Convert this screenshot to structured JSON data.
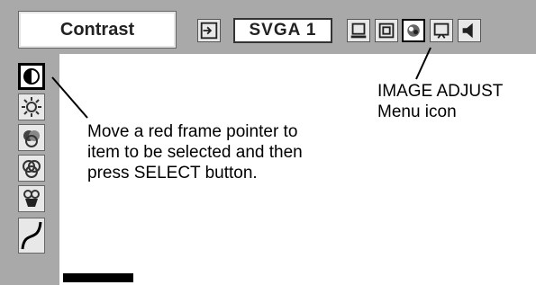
{
  "menu": {
    "title": "Contrast",
    "source_label": "SVGA 1"
  },
  "toolbar_icons": [
    "input-icon",
    "pc-adjust-icon",
    "image-select-icon",
    "image-adjust-icon",
    "screen-icon",
    "sound-icon"
  ],
  "side_icons": [
    "contrast-icon",
    "brightness-icon",
    "color-icon",
    "tint-icon",
    "white-balance-icon",
    "gamma-icon"
  ],
  "annotations": {
    "image_adjust": [
      "IMAGE ADJUST",
      "Menu icon"
    ],
    "pointer": [
      "Move a red frame pointer to",
      "item to be selected and then",
      "press SELECT button."
    ]
  },
  "colors": {
    "menu_background": "#a9a9a9",
    "icon_face": "#e8e8e8",
    "selected_frame": "#000000"
  }
}
